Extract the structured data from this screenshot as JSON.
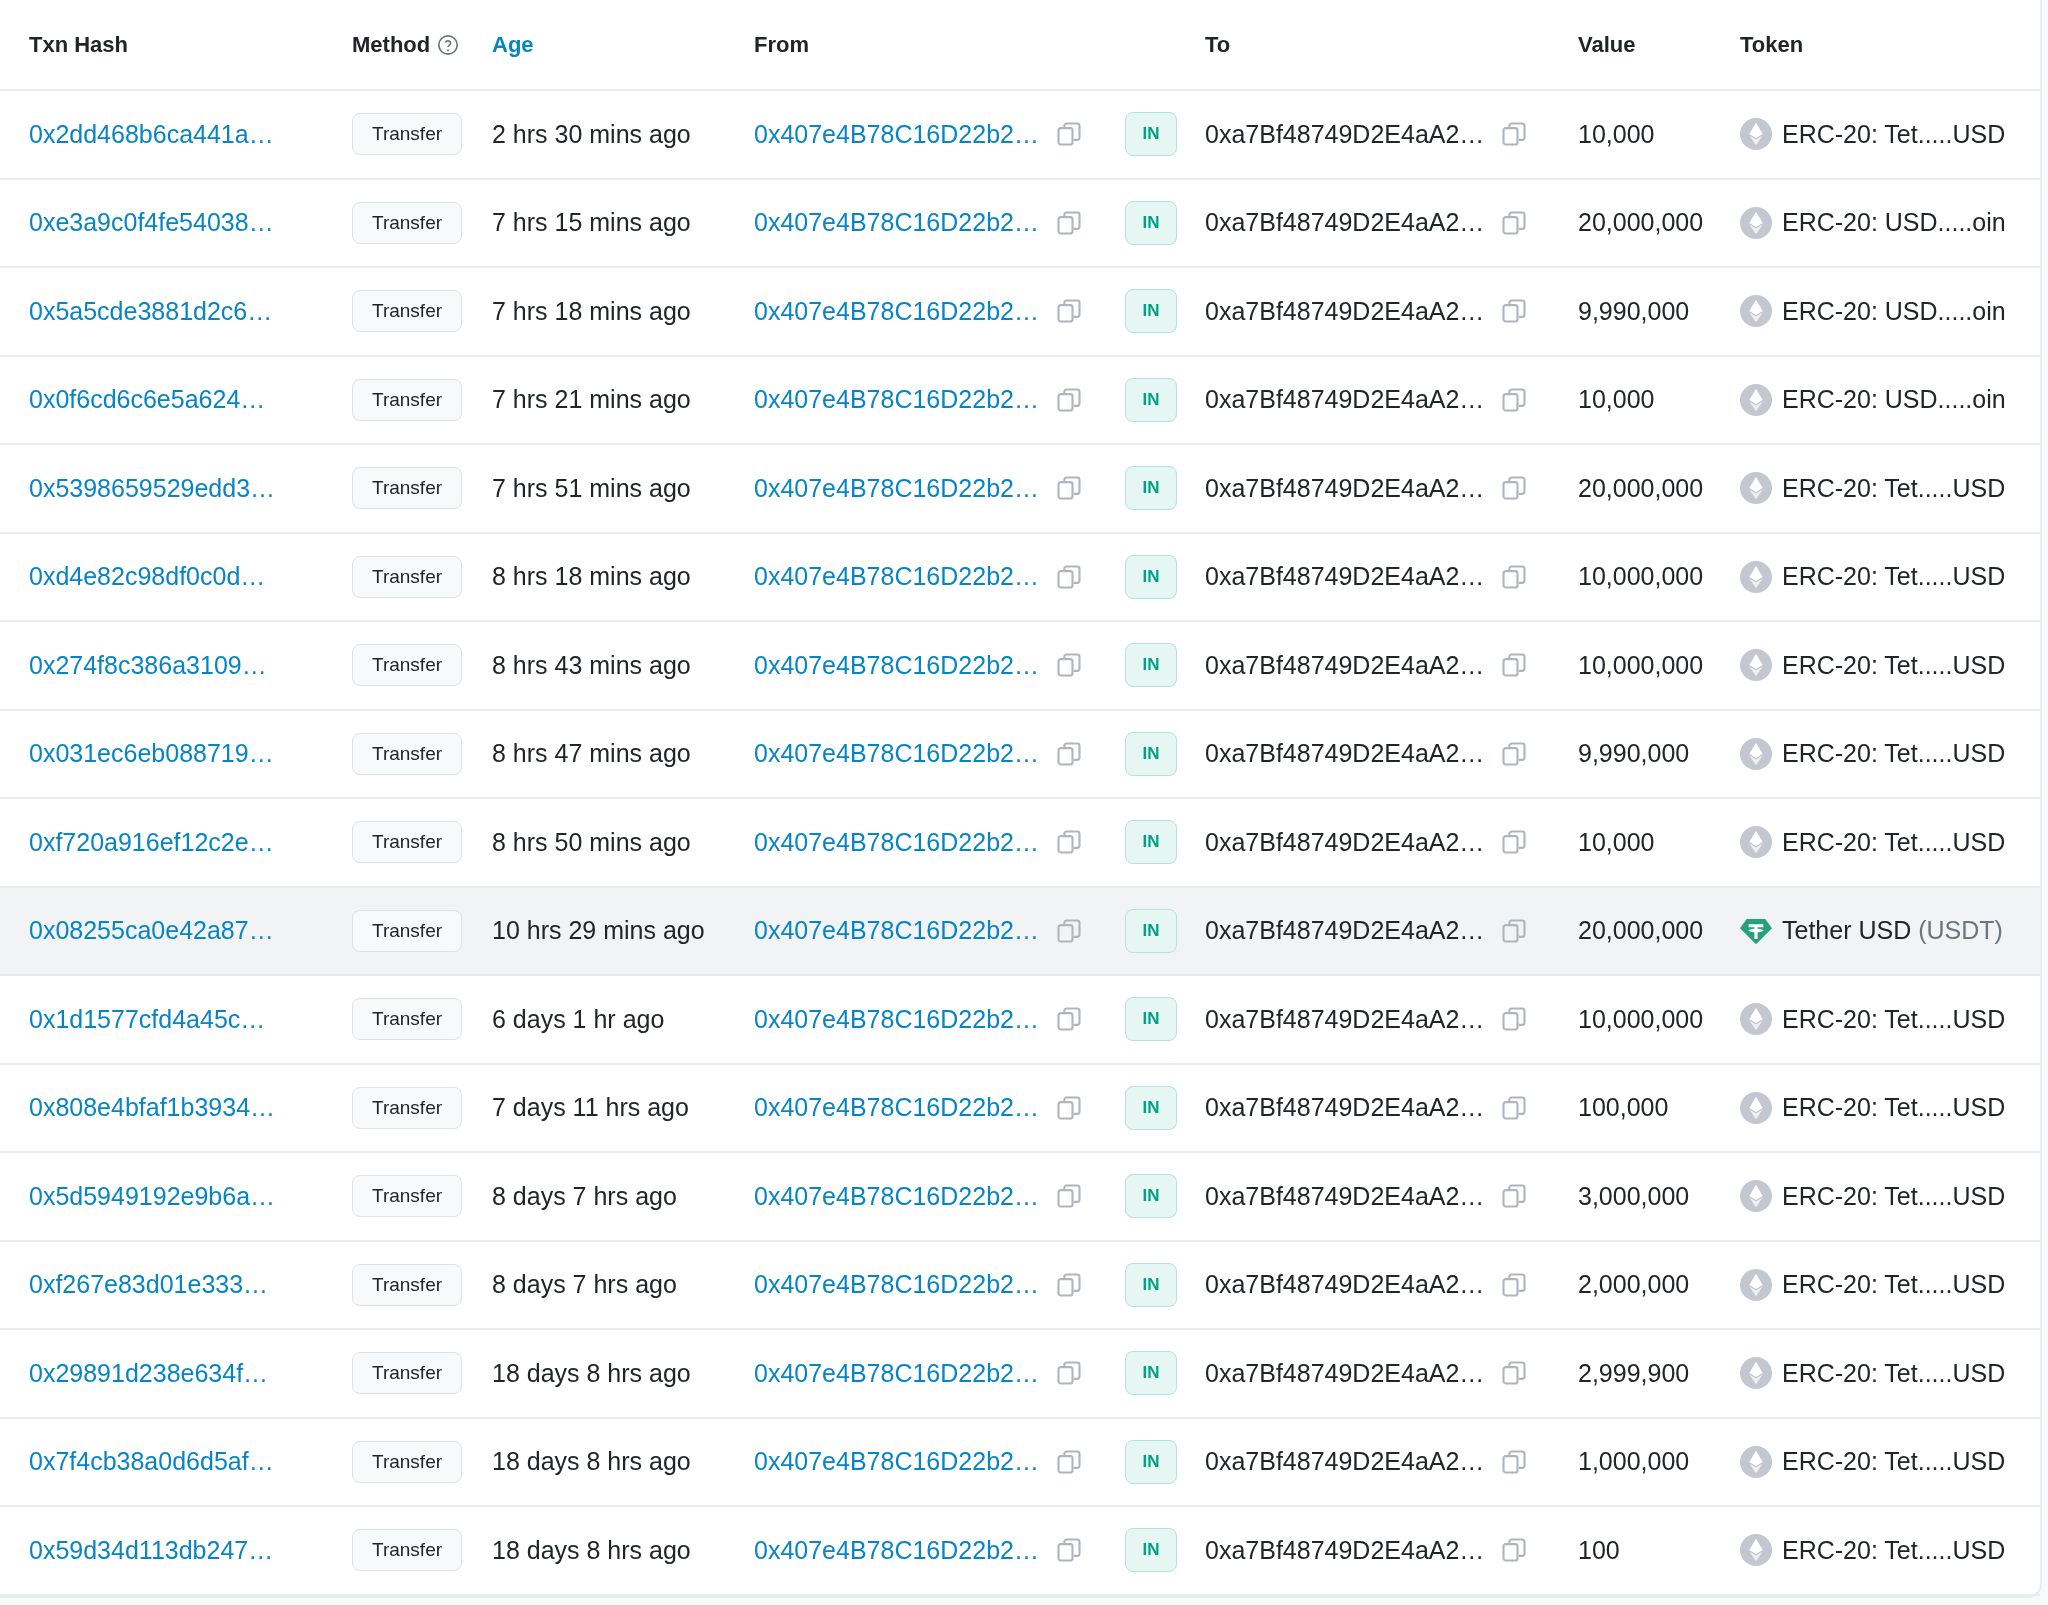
{
  "table": {
    "columns": [
      {
        "label": "Txn Hash",
        "kind": "plain"
      },
      {
        "label": "Method",
        "kind": "help"
      },
      {
        "label": "Age",
        "kind": "link"
      },
      {
        "label": "From",
        "kind": "plain"
      },
      {
        "label": "To",
        "kind": "plain"
      },
      {
        "label": "Value",
        "kind": "plain"
      },
      {
        "label": "Token",
        "kind": "plain"
      }
    ],
    "rows": [
      {
        "hash": "0x2dd468b6ca441a…",
        "method": "Transfer",
        "age": "2 hrs 30 mins ago",
        "from": "0x407e4B78C16D22b2…",
        "direction": "IN",
        "to": "0xa7Bf48749D2E4aA2…",
        "value": "10,000",
        "token": {
          "kind": "erc20",
          "name": "ERC-20: Tet.....USD"
        },
        "highlighted": false
      },
      {
        "hash": "0xe3a9c0f4fe54038…",
        "method": "Transfer",
        "age": "7 hrs 15 mins ago",
        "from": "0x407e4B78C16D22b2…",
        "direction": "IN",
        "to": "0xa7Bf48749D2E4aA2…",
        "value": "20,000,000",
        "token": {
          "kind": "erc20",
          "name": "ERC-20: USD.....oin"
        },
        "highlighted": false
      },
      {
        "hash": "0x5a5cde3881d2c6…",
        "method": "Transfer",
        "age": "7 hrs 18 mins ago",
        "from": "0x407e4B78C16D22b2…",
        "direction": "IN",
        "to": "0xa7Bf48749D2E4aA2…",
        "value": "9,990,000",
        "token": {
          "kind": "erc20",
          "name": "ERC-20: USD.....oin"
        },
        "highlighted": false
      },
      {
        "hash": "0x0f6cd6c6e5a624…",
        "method": "Transfer",
        "age": "7 hrs 21 mins ago",
        "from": "0x407e4B78C16D22b2…",
        "direction": "IN",
        "to": "0xa7Bf48749D2E4aA2…",
        "value": "10,000",
        "token": {
          "kind": "erc20",
          "name": "ERC-20: USD.....oin"
        },
        "highlighted": false
      },
      {
        "hash": "0x5398659529edd3…",
        "method": "Transfer",
        "age": "7 hrs 51 mins ago",
        "from": "0x407e4B78C16D22b2…",
        "direction": "IN",
        "to": "0xa7Bf48749D2E4aA2…",
        "value": "20,000,000",
        "token": {
          "kind": "erc20",
          "name": "ERC-20: Tet.....USD"
        },
        "highlighted": false
      },
      {
        "hash": "0xd4e82c98df0c0d…",
        "method": "Transfer",
        "age": "8 hrs 18 mins ago",
        "from": "0x407e4B78C16D22b2…",
        "direction": "IN",
        "to": "0xa7Bf48749D2E4aA2…",
        "value": "10,000,000",
        "token": {
          "kind": "erc20",
          "name": "ERC-20: Tet.....USD"
        },
        "highlighted": false
      },
      {
        "hash": "0x274f8c386a3109…",
        "method": "Transfer",
        "age": "8 hrs 43 mins ago",
        "from": "0x407e4B78C16D22b2…",
        "direction": "IN",
        "to": "0xa7Bf48749D2E4aA2…",
        "value": "10,000,000",
        "token": {
          "kind": "erc20",
          "name": "ERC-20: Tet.....USD"
        },
        "highlighted": false
      },
      {
        "hash": "0x031ec6eb088719…",
        "method": "Transfer",
        "age": "8 hrs 47 mins ago",
        "from": "0x407e4B78C16D22b2…",
        "direction": "IN",
        "to": "0xa7Bf48749D2E4aA2…",
        "value": "9,990,000",
        "token": {
          "kind": "erc20",
          "name": "ERC-20: Tet.....USD"
        },
        "highlighted": false
      },
      {
        "hash": "0xf720a916ef12c2e…",
        "method": "Transfer",
        "age": "8 hrs 50 mins ago",
        "from": "0x407e4B78C16D22b2…",
        "direction": "IN",
        "to": "0xa7Bf48749D2E4aA2…",
        "value": "10,000",
        "token": {
          "kind": "erc20",
          "name": "ERC-20: Tet.....USD"
        },
        "highlighted": false
      },
      {
        "hash": "0x08255ca0e42a87…",
        "method": "Transfer",
        "age": "10 hrs 29 mins ago",
        "from": "0x407e4B78C16D22b2…",
        "direction": "IN",
        "to": "0xa7Bf48749D2E4aA2…",
        "value": "20,000,000",
        "token": {
          "kind": "tether",
          "name": "Tether USD",
          "symbol": "(USDT)"
        },
        "highlighted": true
      },
      {
        "hash": "0x1d1577cfd4a45c…",
        "method": "Transfer",
        "age": "6 days 1 hr ago",
        "from": "0x407e4B78C16D22b2…",
        "direction": "IN",
        "to": "0xa7Bf48749D2E4aA2…",
        "value": "10,000,000",
        "token": {
          "kind": "erc20",
          "name": "ERC-20: Tet.....USD"
        },
        "highlighted": false
      },
      {
        "hash": "0x808e4bfaf1b3934…",
        "method": "Transfer",
        "age": "7 days 11 hrs ago",
        "from": "0x407e4B78C16D22b2…",
        "direction": "IN",
        "to": "0xa7Bf48749D2E4aA2…",
        "value": "100,000",
        "token": {
          "kind": "erc20",
          "name": "ERC-20: Tet.....USD"
        },
        "highlighted": false
      },
      {
        "hash": "0x5d5949192e9b6a…",
        "method": "Transfer",
        "age": "8 days 7 hrs ago",
        "from": "0x407e4B78C16D22b2…",
        "direction": "IN",
        "to": "0xa7Bf48749D2E4aA2…",
        "value": "3,000,000",
        "token": {
          "kind": "erc20",
          "name": "ERC-20: Tet.....USD"
        },
        "highlighted": false
      },
      {
        "hash": "0xf267e83d01e333…",
        "method": "Transfer",
        "age": "8 days 7 hrs ago",
        "from": "0x407e4B78C16D22b2…",
        "direction": "IN",
        "to": "0xa7Bf48749D2E4aA2…",
        "value": "2,000,000",
        "token": {
          "kind": "erc20",
          "name": "ERC-20: Tet.....USD"
        },
        "highlighted": false
      },
      {
        "hash": "0x29891d238e634f…",
        "method": "Transfer",
        "age": "18 days 8 hrs ago",
        "from": "0x407e4B78C16D22b2…",
        "direction": "IN",
        "to": "0xa7Bf48749D2E4aA2…",
        "value": "2,999,900",
        "token": {
          "kind": "erc20",
          "name": "ERC-20: Tet.....USD"
        },
        "highlighted": false
      },
      {
        "hash": "0x7f4cb38a0d6d5af…",
        "method": "Transfer",
        "age": "18 days 8 hrs ago",
        "from": "0x407e4B78C16D22b2…",
        "direction": "IN",
        "to": "0xa7Bf48749D2E4aA2…",
        "value": "1,000,000",
        "token": {
          "kind": "erc20",
          "name": "ERC-20: Tet.....USD"
        },
        "highlighted": false
      },
      {
        "hash": "0x59d34d113db247…",
        "method": "Transfer",
        "age": "18 days 8 hrs ago",
        "from": "0x407e4B78C16D22b2…",
        "direction": "IN",
        "to": "0xa7Bf48749D2E4aA2…",
        "value": "100",
        "token": {
          "kind": "erc20",
          "name": "ERC-20: Tet.....USD"
        },
        "highlighted": false
      }
    ]
  }
}
